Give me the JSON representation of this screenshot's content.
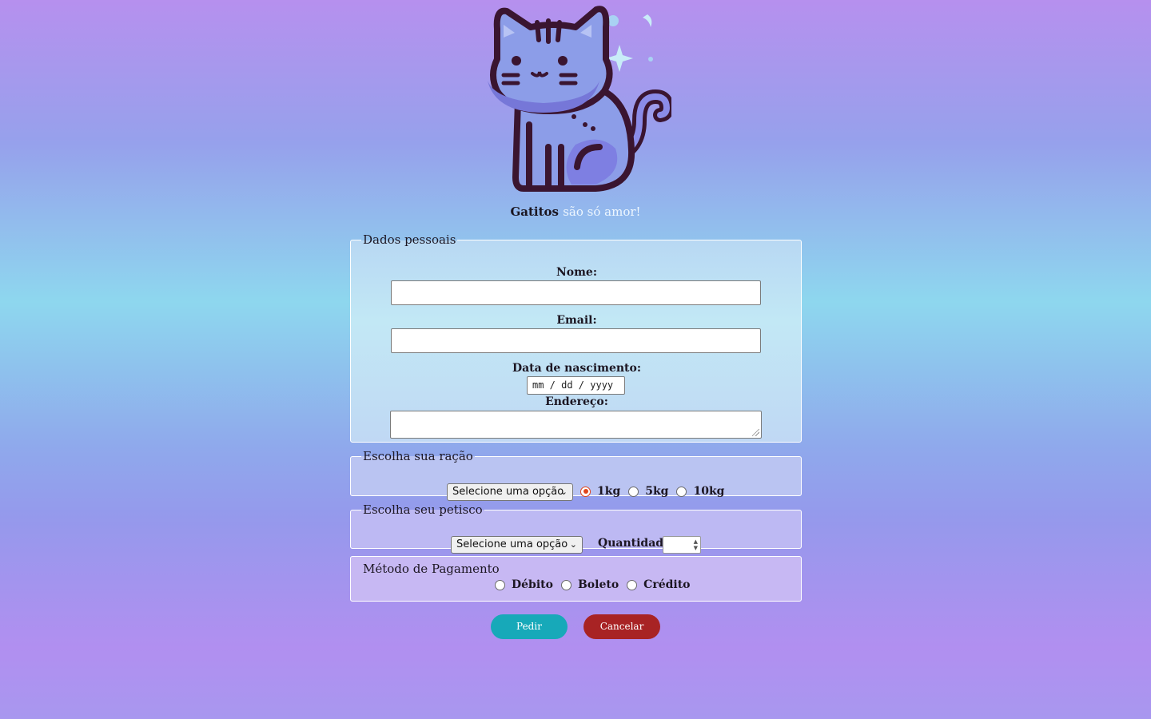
{
  "logo": {
    "icon": "cat-sparkles-icon"
  },
  "tagline": {
    "prefix": "Gatitos",
    "accent": "são só amor!"
  },
  "personal": {
    "legend": "Dados pessoais",
    "name_label": "Nome:",
    "email_label": "Email:",
    "birth_label": "Data de nascimento:",
    "birth_placeholder": "mm / dd / yyyy",
    "address_label": "Endereço:"
  },
  "racao": {
    "legend": "Escolha sua ração",
    "select_value": "Selecione uma opção",
    "options": [
      {
        "label": "1kg",
        "checked": true
      },
      {
        "label": "5kg",
        "checked": false
      },
      {
        "label": "10kg",
        "checked": false
      }
    ]
  },
  "petisco": {
    "legend": "Escolha seu petisco",
    "select_value": "Selecione uma opção",
    "qty_label": "Quantidade"
  },
  "pagamento": {
    "legend": "Método de Pagamento",
    "options": [
      {
        "label": "Débito",
        "checked": false
      },
      {
        "label": "Boleto",
        "checked": false
      },
      {
        "label": "Crédito",
        "checked": false
      }
    ]
  },
  "buttons": {
    "submit": "Pedir",
    "cancel": "Cancelar"
  },
  "colors": {
    "submit": "#17a9b9",
    "cancel": "#a82324",
    "radio_checked": "#e0461c"
  }
}
